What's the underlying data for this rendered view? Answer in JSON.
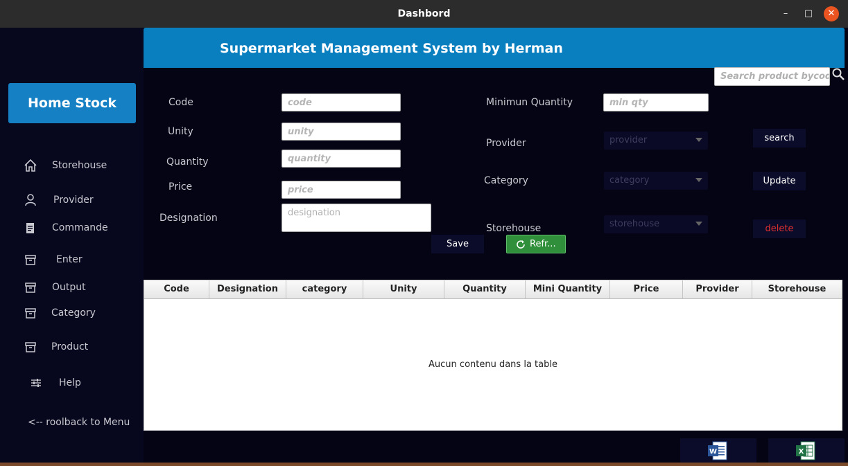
{
  "window": {
    "title": "Dashbord"
  },
  "sidebar": {
    "home_label": "Home Stock",
    "items": [
      {
        "label": "Storehouse",
        "icon": "home-icon"
      },
      {
        "label": "Provider",
        "icon": "user-icon"
      },
      {
        "label": "Commande",
        "icon": "clipboard-icon"
      },
      {
        "label": "Enter",
        "icon": "archive-icon"
      },
      {
        "label": "Output",
        "icon": "archive-icon"
      },
      {
        "label": "Category",
        "icon": "archive-icon"
      },
      {
        "label": "Product",
        "icon": "archive-icon"
      },
      {
        "label": "Help",
        "icon": "sliders-icon"
      }
    ],
    "rollback_label": "<-- roolback to Menu"
  },
  "header": {
    "title": "Supermarket Management System by Herman"
  },
  "search": {
    "placeholder": "Search product bycode"
  },
  "form": {
    "code_label": "Code",
    "code_placeholder": "code",
    "unity_label": "Unity",
    "unity_placeholder": "unity",
    "quantity_label": "Quantity",
    "quantity_placeholder": "quantity",
    "price_label": "Price",
    "price_placeholder": "price",
    "designation_label": "Designation",
    "designation_placeholder": "designation",
    "min_qty_label": "Minimun Quantity",
    "min_qty_placeholder": "min qty",
    "provider_label": "Provider",
    "provider_value": "provider",
    "category_label": "Category",
    "category_value": "category",
    "storehouse_label": "Storehouse",
    "storehouse_value": "storehouse"
  },
  "buttons": {
    "save": "Save",
    "refresh": "Refr...",
    "search": "search",
    "update": "Update",
    "delete": "delete"
  },
  "table": {
    "columns": [
      "Code",
      "Designation",
      "category",
      "Unity",
      "Quantity",
      "Mini Quantity",
      "Price",
      "Provider",
      "Storehouse"
    ],
    "empty_message": "Aucun contenu dans la table"
  },
  "export": {
    "word_icon": "word-doc-icon",
    "excel_icon": "excel-doc-icon"
  },
  "colors": {
    "accent": "#0a7fc0",
    "sidebar_bg": "#07071e",
    "main_bg": "#050414",
    "refresh": "#2f8f3a",
    "delete_text": "#e03030"
  }
}
